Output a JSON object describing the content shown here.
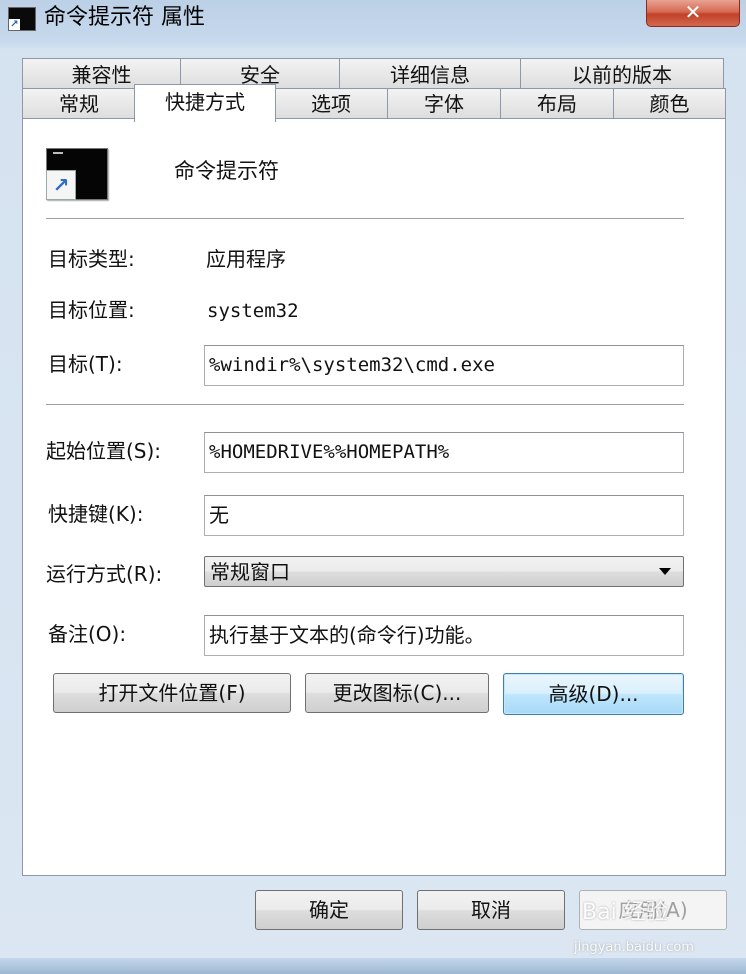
{
  "window": {
    "title": "命令提示符 属性",
    "close_label": "✕"
  },
  "tabs": {
    "row1": [
      "兼容性",
      "安全",
      "详细信息",
      "以前的版本"
    ],
    "row2": [
      "常规",
      "快捷方式",
      "选项",
      "字体",
      "布局",
      "颜色"
    ],
    "active": "快捷方式"
  },
  "shortcut": {
    "icon": "cmd-shortcut-icon",
    "name": "命令提示符",
    "target_type_label": "目标类型:",
    "target_type_value": "应用程序",
    "target_location_label": "目标位置:",
    "target_location_value": "system32",
    "target_label": "目标(T):",
    "target_value": "%windir%\\system32\\cmd.exe",
    "start_in_label": "起始位置(S):",
    "start_in_value": "%HOMEDRIVE%%HOMEPATH%",
    "hotkey_label": "快捷键(K):",
    "hotkey_value": "无",
    "run_label": "运行方式(R):",
    "run_value": "常规窗口",
    "comment_label": "备注(O):",
    "comment_value": "执行基于文本的(命令行)功能。",
    "open_location_button": "打开文件位置(F)",
    "change_icon_button": "更改图标(C)...",
    "advanced_button": "高级(D)..."
  },
  "footer": {
    "ok": "确定",
    "cancel": "取消",
    "apply": "应用(A)"
  },
  "watermark": {
    "line1": "Bai 经验",
    "line2": "jingyan.baidu.com"
  },
  "colors": {
    "accent": "#3c7fb1",
    "close": "#c2412a"
  }
}
